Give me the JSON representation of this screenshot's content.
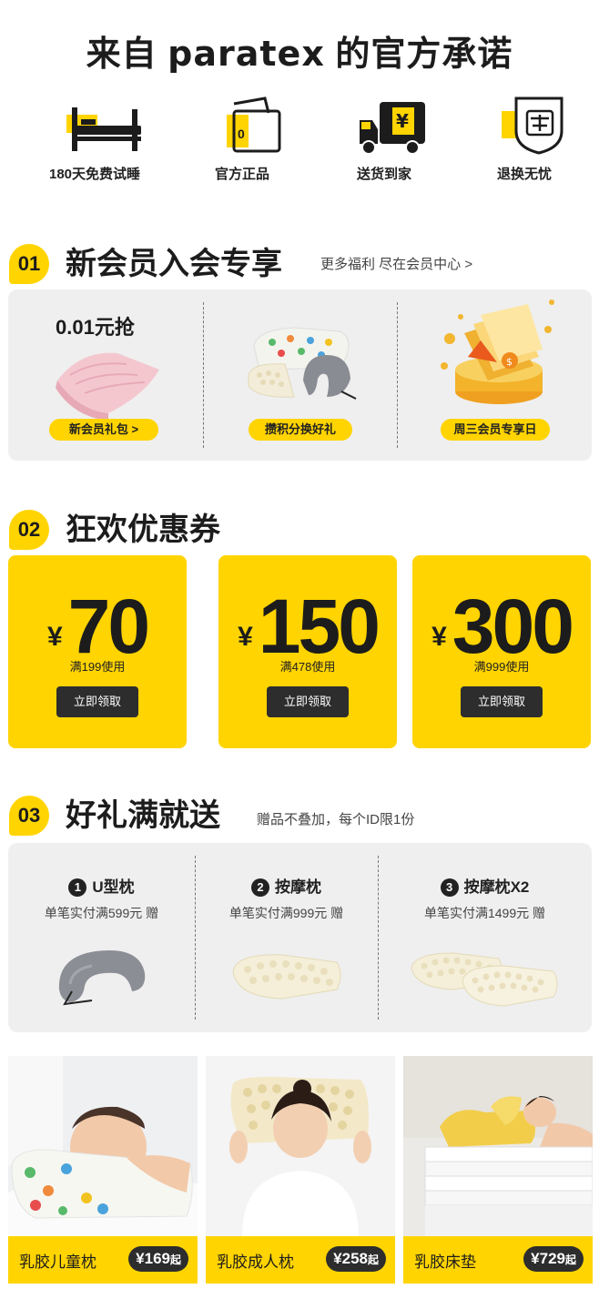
{
  "header": {
    "title_prefix": "来自",
    "brand": "paratex",
    "title_suffix": "的官方承诺"
  },
  "promises": [
    {
      "icon": "bed-icon",
      "label": "180天免费试睡"
    },
    {
      "icon": "wallet-icon",
      "label": "官方正品"
    },
    {
      "icon": "delivery-truck-icon",
      "label": "送货到家"
    },
    {
      "icon": "shield-return-icon",
      "label": "退换无忧"
    }
  ],
  "section1": {
    "num": "01",
    "title": "新会员入会专享",
    "subtitle": "更多福利 尽在会员中心 >",
    "price_text": "0.01元抢",
    "items": [
      {
        "label": "新会员礼包 >"
      },
      {
        "label": "攒积分换好礼"
      },
      {
        "label": "周三会员专享日"
      }
    ]
  },
  "section2": {
    "num": "02",
    "title": "狂欢优惠券",
    "coupons": [
      {
        "currency": "¥",
        "amount": "70",
        "condition": "满199使用",
        "button": "立即领取"
      },
      {
        "currency": "¥",
        "amount": "150",
        "condition": "满478使用",
        "button": "立即领取"
      },
      {
        "currency": "¥",
        "amount": "300",
        "condition": "满999使用",
        "button": "立即领取"
      }
    ]
  },
  "section3": {
    "num": "03",
    "title": "好礼满就送",
    "subtitle": "赠品不叠加，每个ID限1份",
    "gifts": [
      {
        "index": "1",
        "name": "U型枕",
        "condition": "单笔实付满599元 赠"
      },
      {
        "index": "2",
        "name": "按摩枕",
        "condition": "单笔实付满999元 赠"
      },
      {
        "index": "3",
        "name": "按摩枕X2",
        "condition": "单笔实付满1499元 赠"
      }
    ]
  },
  "products": [
    {
      "name": "乳胶儿童枕",
      "price": "¥169",
      "suffix": "起"
    },
    {
      "name": "乳胶成人枕",
      "price": "¥258",
      "suffix": "起"
    },
    {
      "name": "乳胶床垫",
      "price": "¥729",
      "suffix": "起"
    }
  ],
  "colors": {
    "accent": "#ffd400",
    "dark": "#2d2d2d",
    "panel": "#efefef"
  }
}
